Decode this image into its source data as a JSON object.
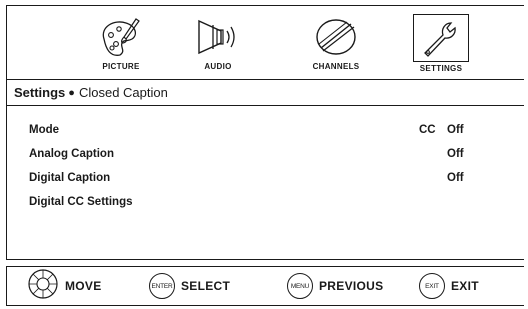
{
  "menu": {
    "tabs": [
      {
        "label": "PICTURE",
        "icon": "palette-icon",
        "selected": false
      },
      {
        "label": "AUDIO",
        "icon": "speaker-icon",
        "selected": false
      },
      {
        "label": "CHANNELS",
        "icon": "satellite-dish-icon",
        "selected": false
      },
      {
        "label": "SETTINGS",
        "icon": "wrench-icon",
        "selected": true
      }
    ]
  },
  "breadcrumb": {
    "section": "Settings",
    "separator": "●",
    "page": "Closed Caption"
  },
  "options": [
    {
      "label": "Mode",
      "prefix": "CC",
      "value": "Off"
    },
    {
      "label": "Analog Caption",
      "prefix": "",
      "value": "Off"
    },
    {
      "label": "Digital Caption",
      "prefix": "",
      "value": "Off"
    },
    {
      "label": "Digital CC Settings",
      "prefix": "",
      "value": ""
    }
  ],
  "nav": {
    "move": {
      "key": "",
      "label": "MOVE"
    },
    "select": {
      "key": "ENTER",
      "label": "SELECT"
    },
    "previous": {
      "key": "MENU",
      "label": "PREVIOUS"
    },
    "exit": {
      "key": "EXIT",
      "label": "EXIT"
    }
  },
  "colors": {
    "ink": "#1a1a1a",
    "background": "#ffffff"
  }
}
